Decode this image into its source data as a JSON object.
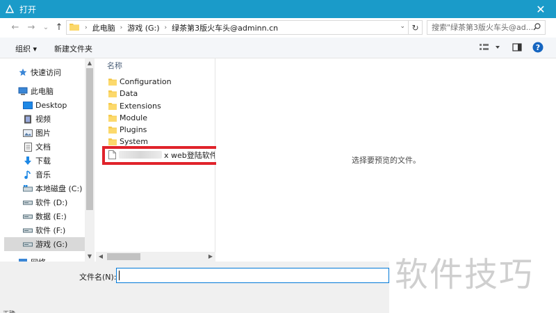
{
  "titlebar": {
    "title": "打开",
    "close_glyph": "✕",
    "color": "#1a9bc9"
  },
  "nav": {
    "back_glyph": "←",
    "forward_glyph": "→",
    "recent_glyph": "⌄",
    "up_glyph": "↑"
  },
  "address": {
    "breadcrumbs": [
      "此电脑",
      "游戏 (G:)",
      "绿茶第3版火车头@adminn.cn"
    ],
    "separator": "›",
    "dropdown_glyph": "⌄",
    "refresh_glyph": "↻"
  },
  "search": {
    "placeholder": "搜索\"绿茶第3版火车头@ad...",
    "icon": "magnifier-icon"
  },
  "toolbar": {
    "organize_label": "组织 ▾",
    "new_folder_label": "新建文件夹"
  },
  "sidebar": {
    "items": [
      {
        "label": "快速访问",
        "icon": "star-icon"
      },
      {
        "label": "此电脑",
        "icon": "computer-icon"
      },
      {
        "label": "Desktop",
        "icon": "desktop-icon"
      },
      {
        "label": "视频",
        "icon": "video-icon"
      },
      {
        "label": "图片",
        "icon": "picture-icon"
      },
      {
        "label": "文档",
        "icon": "document-icon"
      },
      {
        "label": "下载",
        "icon": "download-icon"
      },
      {
        "label": "音乐",
        "icon": "music-icon"
      },
      {
        "label": "本地磁盘 (C:)",
        "icon": "windows-drive-icon"
      },
      {
        "label": "软件 (D:)",
        "icon": "drive-icon"
      },
      {
        "label": "数据 (E:)",
        "icon": "drive-icon"
      },
      {
        "label": "软件 (F:)",
        "icon": "drive-icon"
      },
      {
        "label": "游戏 (G:)",
        "icon": "drive-icon",
        "selected": true
      },
      {
        "label": "网络",
        "icon": "network-icon"
      }
    ]
  },
  "filelist": {
    "column_name": "名称",
    "sort_glyph": "^",
    "folders": [
      "Configuration",
      "Data",
      "Extensions",
      "Module",
      "Plugins",
      "System"
    ],
    "highlighted_file": "x web登陆软件发布"
  },
  "preview": {
    "message": "选择要预览的文件。"
  },
  "filename": {
    "label": "文件名(N):",
    "value": ""
  },
  "watermark": "软件技巧",
  "bottom_cut_text": "正确"
}
